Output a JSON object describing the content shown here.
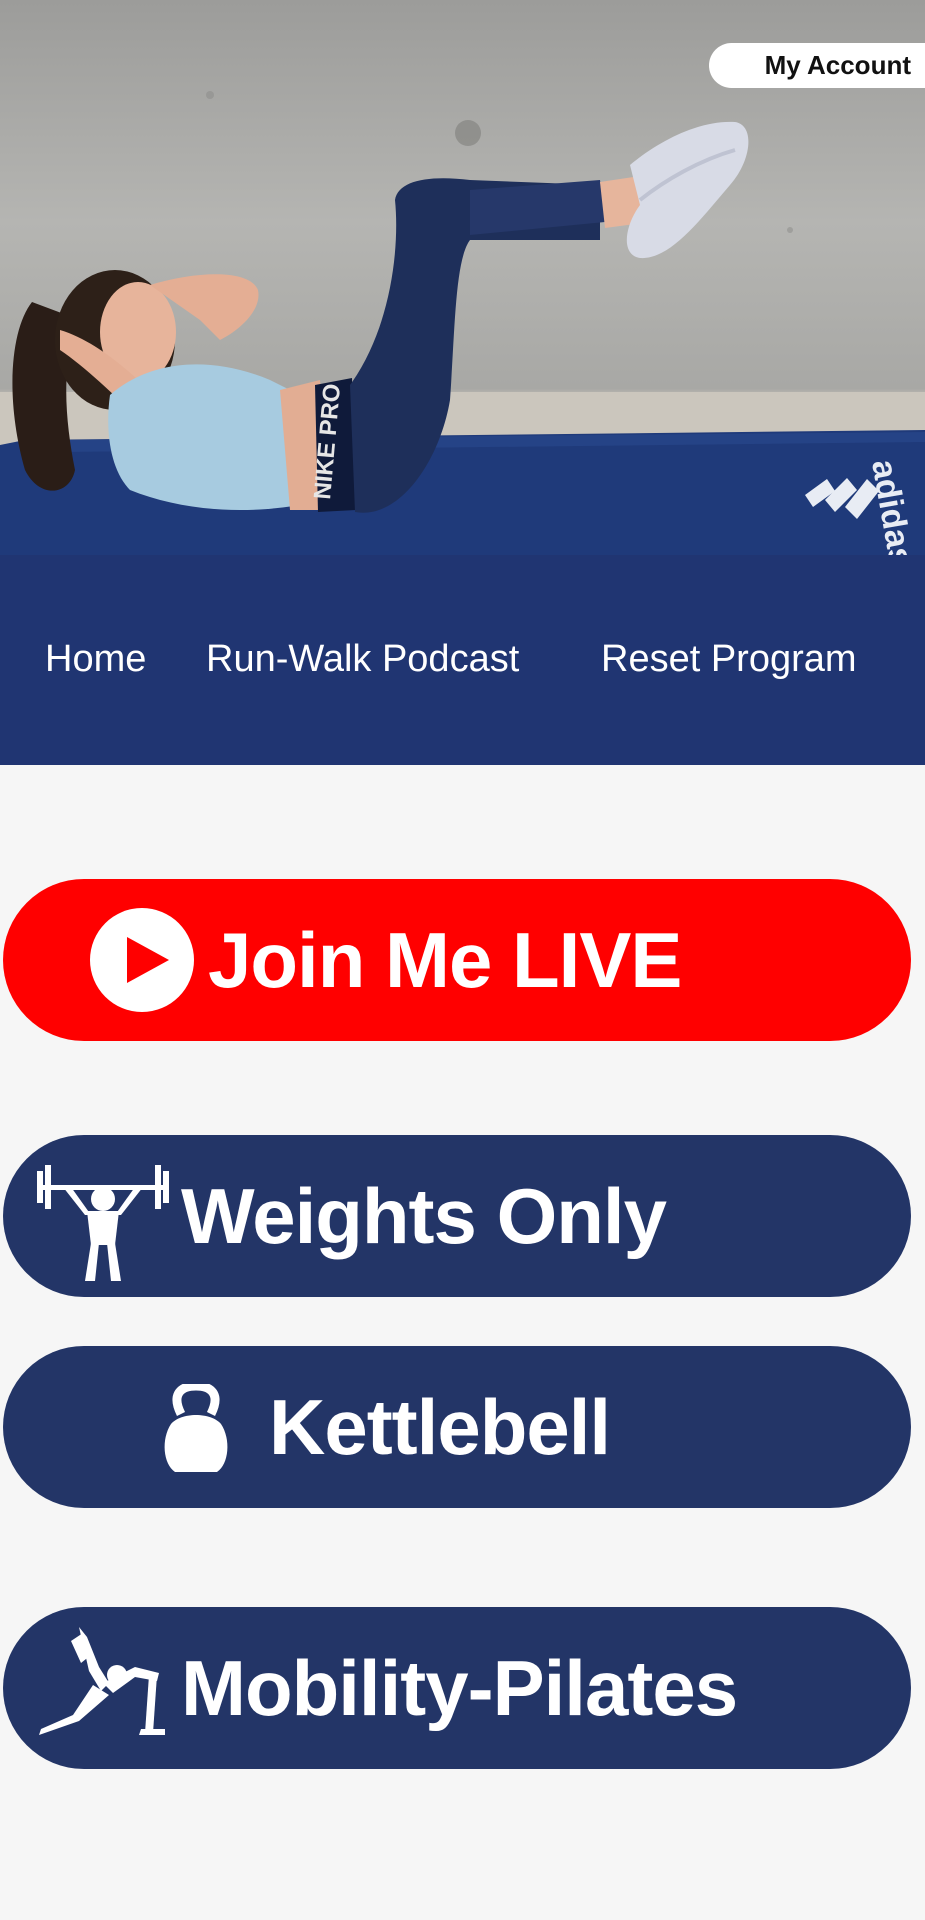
{
  "header": {
    "account_label": "My Account"
  },
  "hero": {
    "mat_brand": "adidas",
    "leggings_brand": "NIKE PRO"
  },
  "nav": {
    "items": [
      {
        "label": "Home"
      },
      {
        "label": "Run-Walk Podcast"
      },
      {
        "label": "Reset Program"
      }
    ]
  },
  "buttons": {
    "live": {
      "label": "Join Me LIVE",
      "icon": "play-icon",
      "color": "#ff0000"
    },
    "weights": {
      "label": "Weights Only",
      "icon": "weightlifter-icon",
      "color": "#233567"
    },
    "kettlebell": {
      "label": "Kettlebell",
      "icon": "kettlebell-icon",
      "color": "#233567"
    },
    "mobility": {
      "label": "Mobility-Pilates",
      "icon": "yoga-pose-icon",
      "color": "#233567"
    }
  },
  "colors": {
    "nav_bg": "#203572",
    "page_bg": "#f6f6f6"
  }
}
